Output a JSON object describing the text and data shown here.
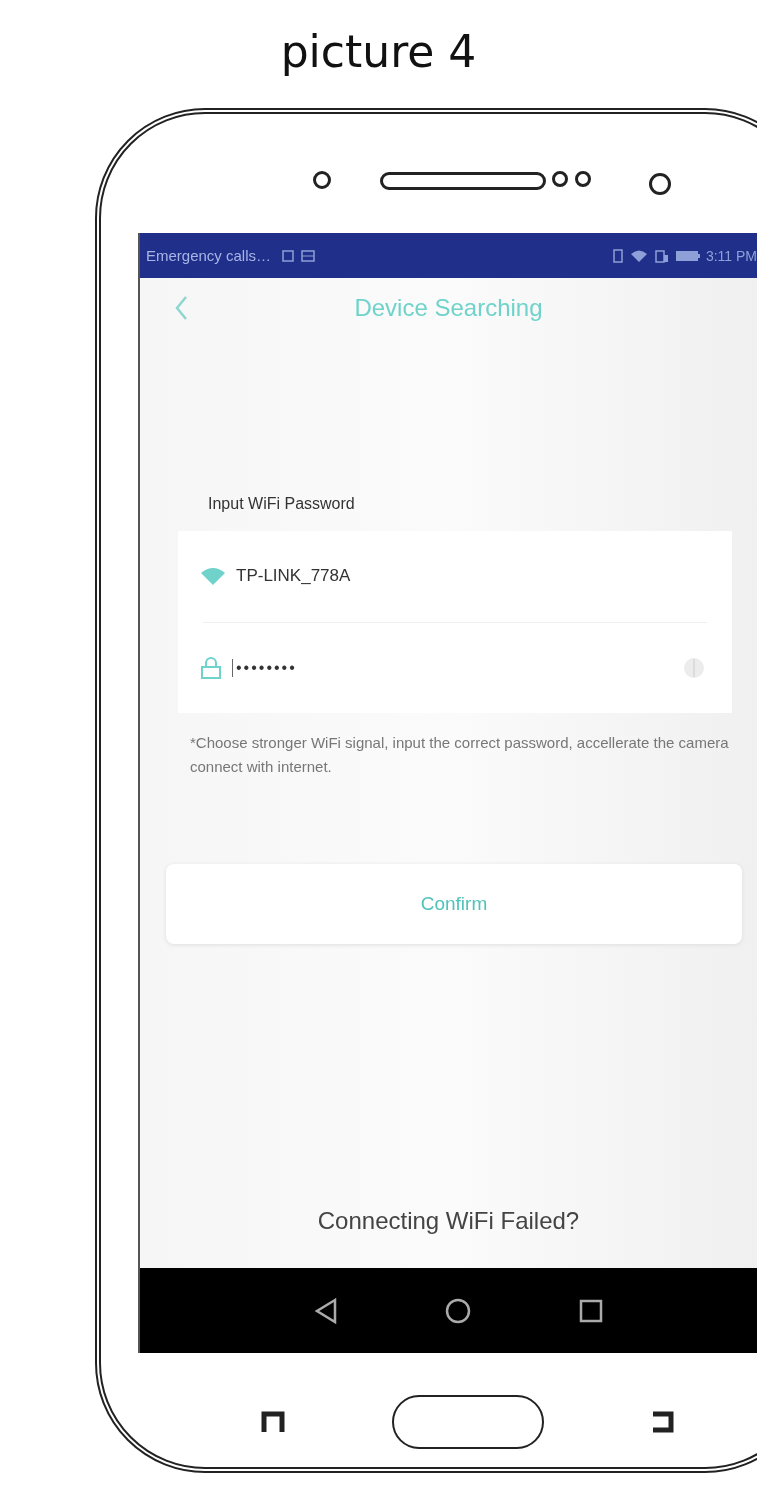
{
  "caption": "picture 4",
  "status_bar": {
    "notification_text": "Emergency calls…",
    "time": "3:11 PM"
  },
  "header": {
    "title": "Device Searching"
  },
  "form": {
    "section_label": "Input WiFi Password",
    "network": "TP-LINK_778A",
    "password": {
      "value": "••••••••"
    },
    "hint": "*Choose stronger WiFi signal, input the correct password, accellerate the camera connect with internet."
  },
  "confirm_button": "Confirm",
  "help_link": "Connecting WiFi Failed?"
}
